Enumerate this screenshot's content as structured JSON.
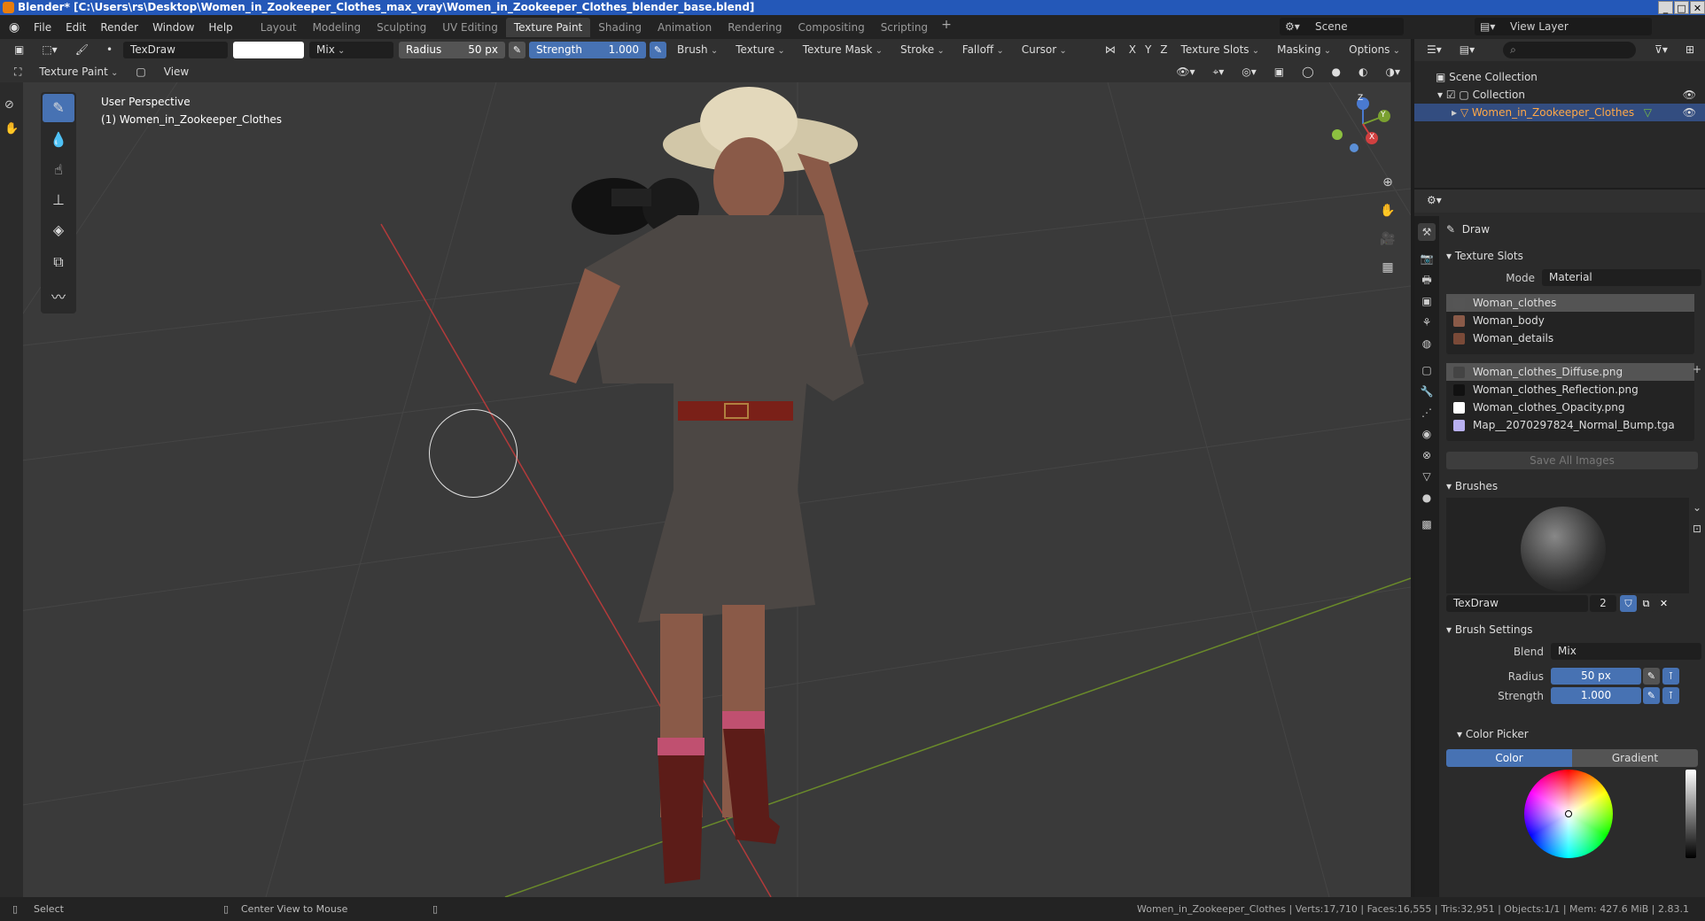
{
  "titlebar": {
    "text": "Blender* [C:\\Users\\rs\\Desktop\\Women_in_Zookeeper_Clothes_max_vray\\Women_in_Zookeeper_Clothes_blender_base.blend]"
  },
  "menu": [
    "File",
    "Edit",
    "Render",
    "Window",
    "Help"
  ],
  "workspaces": [
    "Layout",
    "Modeling",
    "Sculpting",
    "UV Editing",
    "Texture Paint",
    "Shading",
    "Animation",
    "Rendering",
    "Compositing",
    "Scripting"
  ],
  "active_workspace": "Texture Paint",
  "scene": {
    "label": "Scene",
    "view_layer": "View Layer"
  },
  "tool_header": {
    "brush_name": "TexDraw",
    "blend": "Mix",
    "radius_label": "Radius",
    "radius_value": "50 px",
    "strength_label": "Strength",
    "strength_value": "1.000",
    "menus": [
      "Brush",
      "Texture",
      "Texture Mask",
      "Stroke",
      "Falloff",
      "Cursor"
    ],
    "axes": [
      "X",
      "Y",
      "Z"
    ],
    "right_menus": [
      "Texture Slots",
      "Masking",
      "Options"
    ]
  },
  "mode_header": {
    "mode": "Texture Paint",
    "view": "View"
  },
  "viewport": {
    "perspective": "User Perspective",
    "object_label": "(1) Women_in_Zookeeper_Clothes",
    "gizmo": {
      "x": "X",
      "y": "Y",
      "z": "Z"
    }
  },
  "outliner": {
    "scene_collection": "Scene Collection",
    "collection": "Collection",
    "object": "Women_in_Zookeeper_Clothes"
  },
  "properties": {
    "tool_name": "Draw",
    "texture_slots_title": "Texture Slots",
    "mode_label": "Mode",
    "mode_value": "Material",
    "materials": [
      "Woman_clothes",
      "Woman_body",
      "Woman_details"
    ],
    "images": [
      "Woman_clothes_Diffuse.png",
      "Woman_clothes_Reflection.png",
      "Woman_clothes_Opacity.png",
      "Map__2070297824_Normal_Bump.tga"
    ],
    "save_all": "Save All Images",
    "brushes_title": "Brushes",
    "brush_name": "TexDraw",
    "brush_users": "2",
    "brush_settings_title": "Brush Settings",
    "blend_label": "Blend",
    "blend_value": "Mix",
    "radius_label": "Radius",
    "radius_value": "50 px",
    "strength_label": "Strength",
    "strength_value": "1.000",
    "color_picker_title": "Color Picker",
    "color_tab": "Color",
    "gradient_tab": "Gradient"
  },
  "status": {
    "select": "Select",
    "center": "Center View to Mouse",
    "stats": "Women_in_Zookeeper_Clothes | Verts:17,710 | Faces:16,555 | Tris:32,951 | Objects:1/1 | Mem: 427.6 MiB | 2.83.1"
  },
  "colors": {
    "accent": "#4772b3",
    "selected_object": "#ffa847",
    "title_bar": "#2458b8"
  }
}
